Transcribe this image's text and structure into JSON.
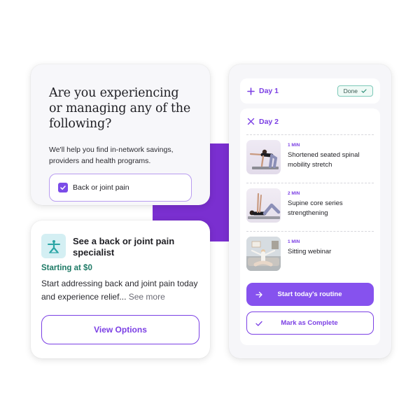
{
  "question_card": {
    "title": "Are you experiencing or managing any of the following?",
    "subtitle": "We'll help you find in-network savings, providers and health programs.",
    "option": {
      "label": "Back or joint pain",
      "checked": true,
      "icon": "check-icon"
    }
  },
  "specialist_card": {
    "icon": "stretching-person-icon",
    "title": "See a back or joint pain specialist",
    "price": "Starting at $0",
    "description": "Start addressing back and joint pain today and experience relief...",
    "see_more": "See more",
    "button_label": "View Options"
  },
  "routine_panel": {
    "day1": {
      "label": "Day 1",
      "icon": "plus-icon",
      "badge": "Done",
      "badge_icon": "check-icon"
    },
    "day2": {
      "label": "Day 2",
      "icon": "close-icon",
      "exercises": [
        {
          "duration": "1 MIN",
          "name": "Shortened seated spinal mobility stretch",
          "thumbnail": "woman on all fours stretching on yoga mat"
        },
        {
          "duration": "2 MIN",
          "name": "Supine core series strengthening",
          "thumbnail": "woman lying on back raising arms and knees"
        },
        {
          "duration": "1 MIN",
          "name": "Sitting webinar",
          "thumbnail": "woman sitting cross-legged on sofa stretching"
        }
      ]
    },
    "start_button": {
      "label": "Start today's routine",
      "icon": "arrow-right-icon"
    },
    "complete_button": {
      "label": "Mark as Complete",
      "icon": "check-icon"
    }
  },
  "colors": {
    "accent_purple": "#7b3fe4",
    "button_purple": "#8652ee",
    "block_purple": "#7a2fd0",
    "price_green": "#1e7a66",
    "done_border": "#7dc9b8",
    "icon_bg": "#d4eff3"
  }
}
